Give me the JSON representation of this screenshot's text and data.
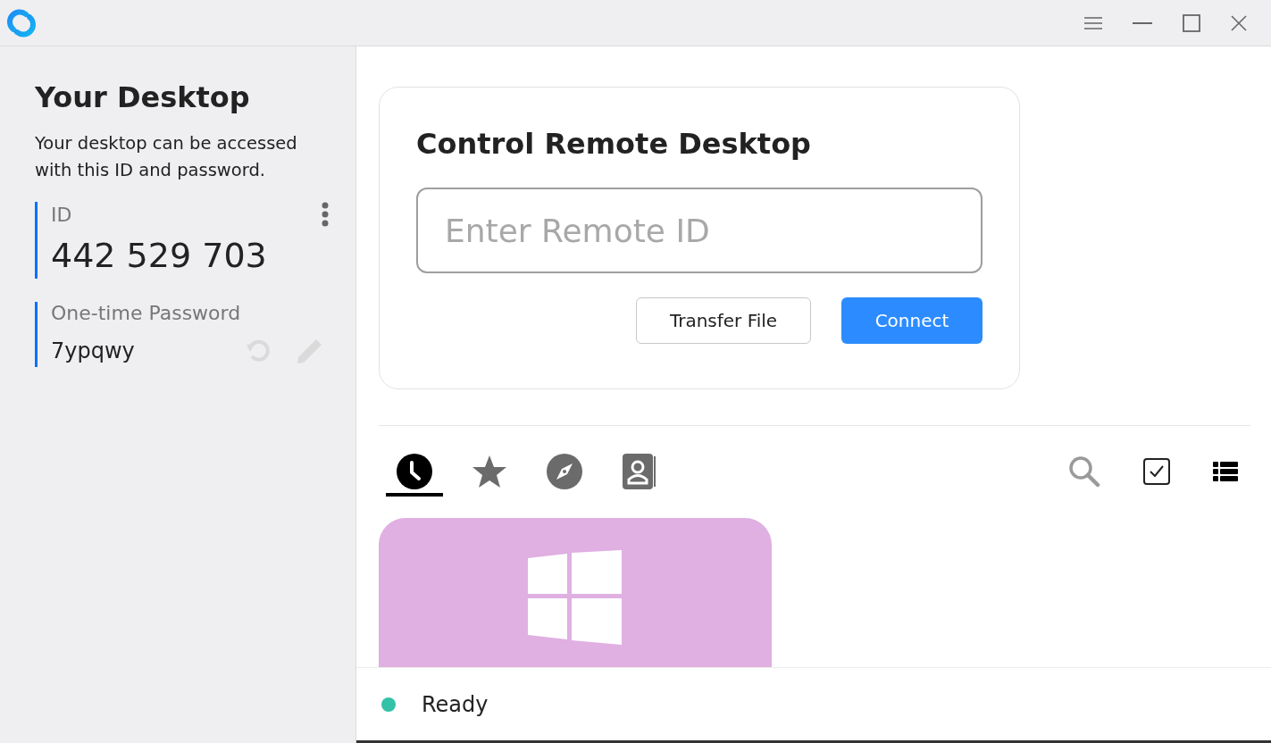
{
  "sidebar": {
    "title": "Your Desktop",
    "description": "Your desktop can be accessed with this ID and password.",
    "id_label": "ID",
    "id_value": "442 529 703",
    "password_label": "One-time Password",
    "password_value": "7ypqwy"
  },
  "connect_card": {
    "title": "Control Remote Desktop",
    "remote_id": {
      "placeholder": "Enter Remote ID"
    },
    "buttons": [
      {
        "label": "Transfer File",
        "kind": "secondary"
      },
      {
        "label": "Connect",
        "kind": "primary"
      }
    ]
  },
  "peer_tabs": [
    {
      "kind": "recent",
      "selected": true
    },
    {
      "kind": "favorites",
      "selected": false
    },
    {
      "kind": "discovered",
      "selected": false
    },
    {
      "kind": "address-book",
      "selected": false
    }
  ],
  "peers": [
    {
      "color": "#dfb0e1"
    }
  ],
  "status_bar": {
    "text": "Ready",
    "color": "#33c1a8"
  }
}
